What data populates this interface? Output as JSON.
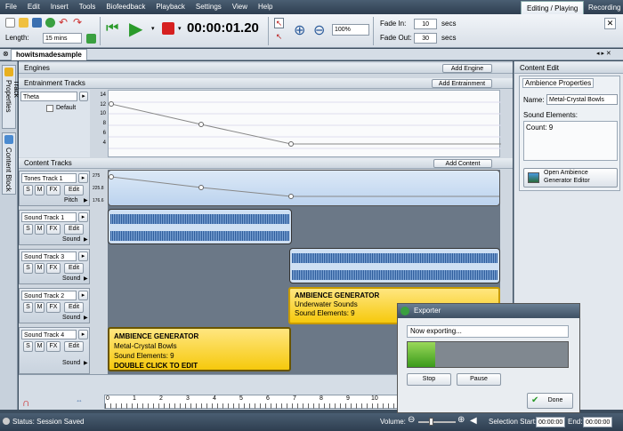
{
  "menu": [
    "File",
    "Edit",
    "Insert",
    "Tools",
    "Biofeedback",
    "Playback",
    "Settings",
    "View",
    "Help"
  ],
  "mode_tabs": {
    "active": "Editing / Playing",
    "other": "Recording"
  },
  "toolbar": {
    "length_label": "Length:",
    "length_value": "15 mins",
    "time_display": "00:00:01.20",
    "zoom_value": "100%",
    "fade_in_label": "Fade In:",
    "fade_in_value": "10",
    "fade_out_label": "Fade Out:",
    "fade_out_value": "30",
    "secs_label": "secs"
  },
  "document_tab": "howitsmadesample",
  "sidebar_tabs": [
    "Track Properties",
    "Content Block"
  ],
  "engines": {
    "title": "Engines",
    "add_button": "Add Engine"
  },
  "entrainment": {
    "title": "Entrainment Tracks",
    "add_button": "Add Entrainment",
    "track_name": "Theta",
    "default_label": "Default",
    "axis_ticks": [
      "14",
      "12",
      "10",
      "8",
      "6",
      "4"
    ]
  },
  "content": {
    "title": "Content Tracks",
    "add_button": "Add Content",
    "tracks": [
      {
        "name": "Tones Track 1",
        "param": "Pitch",
        "ticks": [
          "275",
          "225.8",
          "176.6"
        ]
      },
      {
        "name": "Sound Track 1",
        "param": "Sound"
      },
      {
        "name": "Sound Track 3",
        "param": "Sound"
      },
      {
        "name": "Sound Track 2",
        "param": "Sound"
      },
      {
        "name": "Sound Track 4",
        "param": "Sound"
      }
    ],
    "buttons": {
      "s": "S",
      "m": "M",
      "fx": "FX",
      "edit": "Edit"
    },
    "ambience_clip_1": {
      "title": "AMBIENCE GENERATOR",
      "line1": "Underwater Sounds",
      "line2": "Sound Elements: 9"
    },
    "ambience_clip_2": {
      "title": "AMBIENCE GENERATOR",
      "line1": "Metal-Crystal Bowls",
      "line2": "Sound Elements: 9",
      "hint": "DOUBLE CLICK TO EDIT"
    }
  },
  "timeline_ticks": [
    "0",
    "1",
    "2",
    "3",
    "4",
    "5",
    "6",
    "7",
    "8",
    "9",
    "10",
    "11"
  ],
  "right_panel": {
    "title": "Content Edit",
    "group": "Ambience Properties",
    "name_label": "Name:",
    "name_value": "Metal-Crystal Bowls",
    "elements_label": "Sound Elements:",
    "count_text": "Count: 9",
    "open_button": "Open Ambience Generator Editor"
  },
  "exporter": {
    "title": "Exporter",
    "status": "Now exporting...",
    "progress": 0.17,
    "stop": "Stop",
    "pause": "Pause",
    "done": "Done"
  },
  "statusbar": {
    "status": "Status: Session Saved",
    "volume_label": "Volume:",
    "selection_start_label": "Selection Start:",
    "selection_start": "00:00:00",
    "end_label": "End:",
    "end_value": "00:00:00"
  }
}
